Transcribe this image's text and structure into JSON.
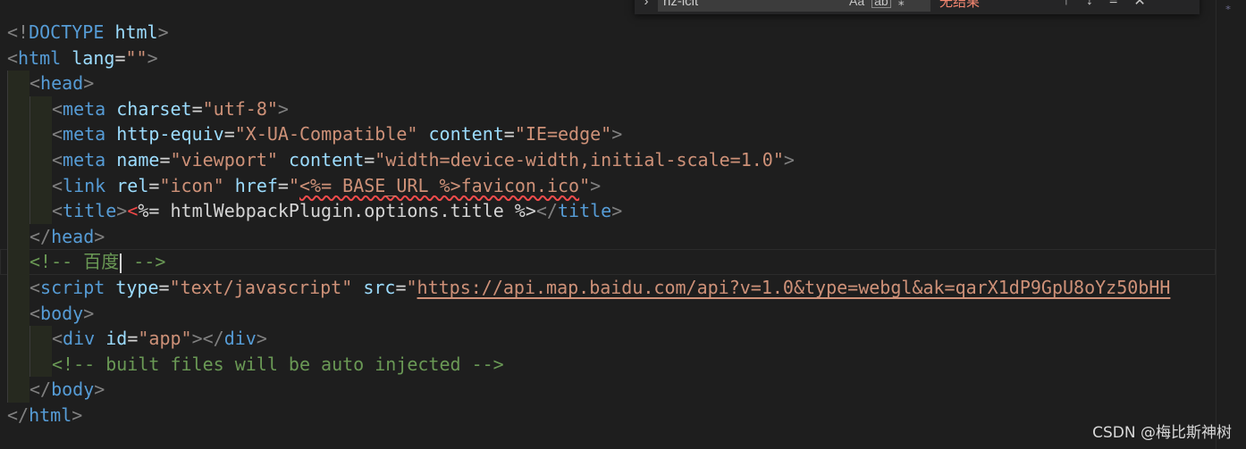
{
  "find_widget": {
    "toggle_icon": "chevron-right-icon",
    "query": "nz-icit",
    "match_case_label": "Aa",
    "whole_word_label": "ab",
    "regex_label": "⁎",
    "result_text": "无结果",
    "prev_icon": "arrow-up-icon",
    "next_icon": "arrow-down-icon",
    "selection_icon": "find-in-selection-icon",
    "close_icon": "close-icon"
  },
  "code_lines": [
    {
      "indent": 0,
      "tokens": [
        [
          "punct",
          "<!"
        ],
        [
          "tag",
          "DOCTYPE"
        ],
        [
          "text",
          " "
        ],
        [
          "attr",
          "html"
        ],
        [
          "punct",
          ">"
        ]
      ]
    },
    {
      "indent": 0,
      "tokens": [
        [
          "punct",
          "<"
        ],
        [
          "tag",
          "html"
        ],
        [
          "text",
          " "
        ],
        [
          "attr",
          "lang"
        ],
        [
          "eq",
          "="
        ],
        [
          "str",
          "\"\""
        ],
        [
          "punct",
          ">"
        ]
      ]
    },
    {
      "indent": 1,
      "tokens": [
        [
          "punct",
          "<"
        ],
        [
          "tag",
          "head"
        ],
        [
          "punct",
          ">"
        ]
      ]
    },
    {
      "indent": 2,
      "tokens": [
        [
          "punct",
          "<"
        ],
        [
          "tag",
          "meta"
        ],
        [
          "text",
          " "
        ],
        [
          "attr",
          "charset"
        ],
        [
          "eq",
          "="
        ],
        [
          "str",
          "\"utf-8\""
        ],
        [
          "punct",
          ">"
        ]
      ]
    },
    {
      "indent": 2,
      "tokens": [
        [
          "punct",
          "<"
        ],
        [
          "tag",
          "meta"
        ],
        [
          "text",
          " "
        ],
        [
          "attr",
          "http-equiv"
        ],
        [
          "eq",
          "="
        ],
        [
          "str",
          "\"X-UA-Compatible\""
        ],
        [
          "text",
          " "
        ],
        [
          "attr",
          "content"
        ],
        [
          "eq",
          "="
        ],
        [
          "str",
          "\"IE=edge\""
        ],
        [
          "punct",
          ">"
        ]
      ]
    },
    {
      "indent": 2,
      "tokens": [
        [
          "punct",
          "<"
        ],
        [
          "tag",
          "meta"
        ],
        [
          "text",
          " "
        ],
        [
          "attr",
          "name"
        ],
        [
          "eq",
          "="
        ],
        [
          "str",
          "\"viewport\""
        ],
        [
          "text",
          " "
        ],
        [
          "attr",
          "content"
        ],
        [
          "eq",
          "="
        ],
        [
          "str",
          "\"width=device-width,initial-scale=1.0\""
        ],
        [
          "punct",
          ">"
        ]
      ]
    },
    {
      "indent": 2,
      "tokens": [
        [
          "punct",
          "<"
        ],
        [
          "tag",
          "link"
        ],
        [
          "text",
          " "
        ],
        [
          "attr",
          "rel"
        ],
        [
          "eq",
          "="
        ],
        [
          "str",
          "\"icon\""
        ],
        [
          "text",
          " "
        ],
        [
          "attr",
          "href"
        ],
        [
          "eq",
          "="
        ],
        [
          "str",
          "\""
        ],
        [
          "str-squiggle",
          "<%= BASE_URL %>favicon.ico"
        ],
        [
          "str",
          "\""
        ],
        [
          "punct",
          ">"
        ]
      ]
    },
    {
      "indent": 2,
      "tokens": [
        [
          "punct",
          "<"
        ],
        [
          "tag",
          "title"
        ],
        [
          "punct",
          ">"
        ],
        [
          "err",
          "<"
        ],
        [
          "text",
          "%= htmlWebpackPlugin.options.title %>"
        ],
        [
          "punct",
          "</"
        ],
        [
          "tag",
          "title"
        ],
        [
          "punct",
          ">"
        ]
      ]
    },
    {
      "indent": 1,
      "tokens": [
        [
          "punct",
          "</"
        ],
        [
          "tag",
          "head"
        ],
        [
          "punct",
          ">"
        ]
      ]
    },
    {
      "indent": 1,
      "cursor": true,
      "tokens": [
        [
          "comment",
          "<!-- 百度"
        ],
        [
          "cursor",
          ""
        ],
        [
          "comment",
          " -->"
        ]
      ]
    },
    {
      "indent": 1,
      "tokens": [
        [
          "punct",
          "<"
        ],
        [
          "tag",
          "script"
        ],
        [
          "text",
          " "
        ],
        [
          "attr",
          "type"
        ],
        [
          "eq",
          "="
        ],
        [
          "str",
          "\"text/javascript\""
        ],
        [
          "text",
          " "
        ],
        [
          "attr",
          "src"
        ],
        [
          "eq",
          "="
        ],
        [
          "str",
          "\""
        ],
        [
          "str-link",
          "https://api.map.baidu.com/api?v=1.0&type=webgl&ak=qarX1dP9GpU8oYz50bHH"
        ]
      ]
    },
    {
      "indent": 1,
      "tokens": [
        [
          "punct",
          "<"
        ],
        [
          "tag",
          "body"
        ],
        [
          "punct",
          ">"
        ]
      ]
    },
    {
      "indent": 2,
      "tokens": [
        [
          "punct",
          "<"
        ],
        [
          "tag",
          "div"
        ],
        [
          "text",
          " "
        ],
        [
          "attr",
          "id"
        ],
        [
          "eq",
          "="
        ],
        [
          "str",
          "\"app\""
        ],
        [
          "punct",
          "></"
        ],
        [
          "tag",
          "div"
        ],
        [
          "punct",
          ">"
        ]
      ]
    },
    {
      "indent": 2,
      "tokens": [
        [
          "comment",
          "<!-- built files will be auto injected -->"
        ]
      ]
    },
    {
      "indent": 1,
      "tokens": [
        [
          "punct",
          "</"
        ],
        [
          "tag",
          "body"
        ],
        [
          "punct",
          ">"
        ]
      ]
    },
    {
      "indent": 0,
      "tokens": [
        [
          "punct",
          "</"
        ],
        [
          "tag",
          "html"
        ],
        [
          "punct",
          ">"
        ]
      ]
    }
  ],
  "scroll_marker": "⁎",
  "watermark": "CSDN @梅比斯神树"
}
